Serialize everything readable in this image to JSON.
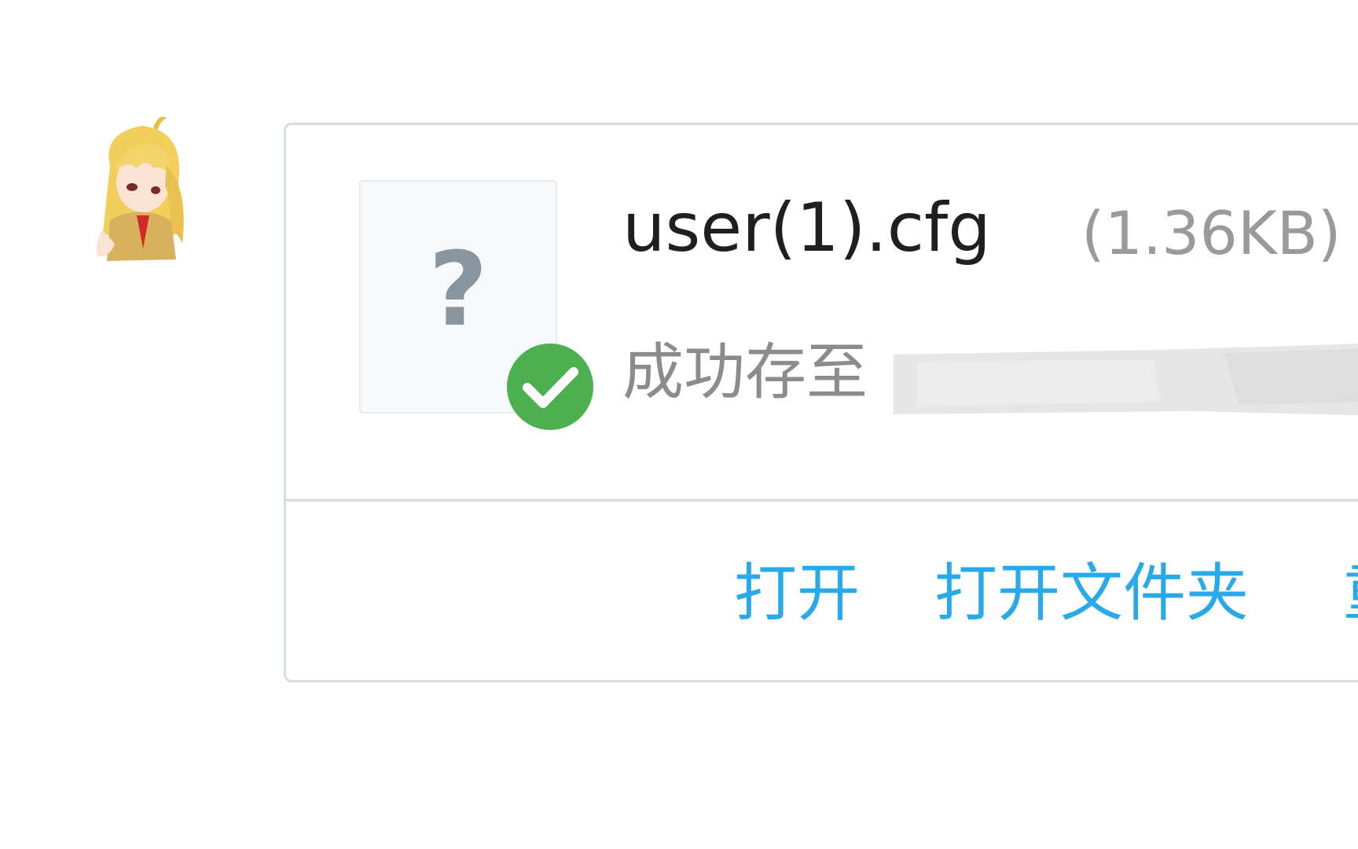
{
  "avatar": {
    "icon": "anime-character-avatar"
  },
  "file": {
    "type_icon": "question-mark-icon",
    "type_glyph": "?",
    "name": "user(1).cfg",
    "size": "(1.36KB)",
    "status_text": "成功存至",
    "status_icon": "check-circle-icon",
    "status_color": "#4caf50"
  },
  "actions": {
    "open": "打开",
    "open_folder": "打开文件夹",
    "more_partial": "重"
  },
  "colors": {
    "link": "#28a9ea",
    "card_border": "#d4dde7",
    "name_text": "#1f1f1f",
    "muted_text": "#8c8c8c"
  }
}
